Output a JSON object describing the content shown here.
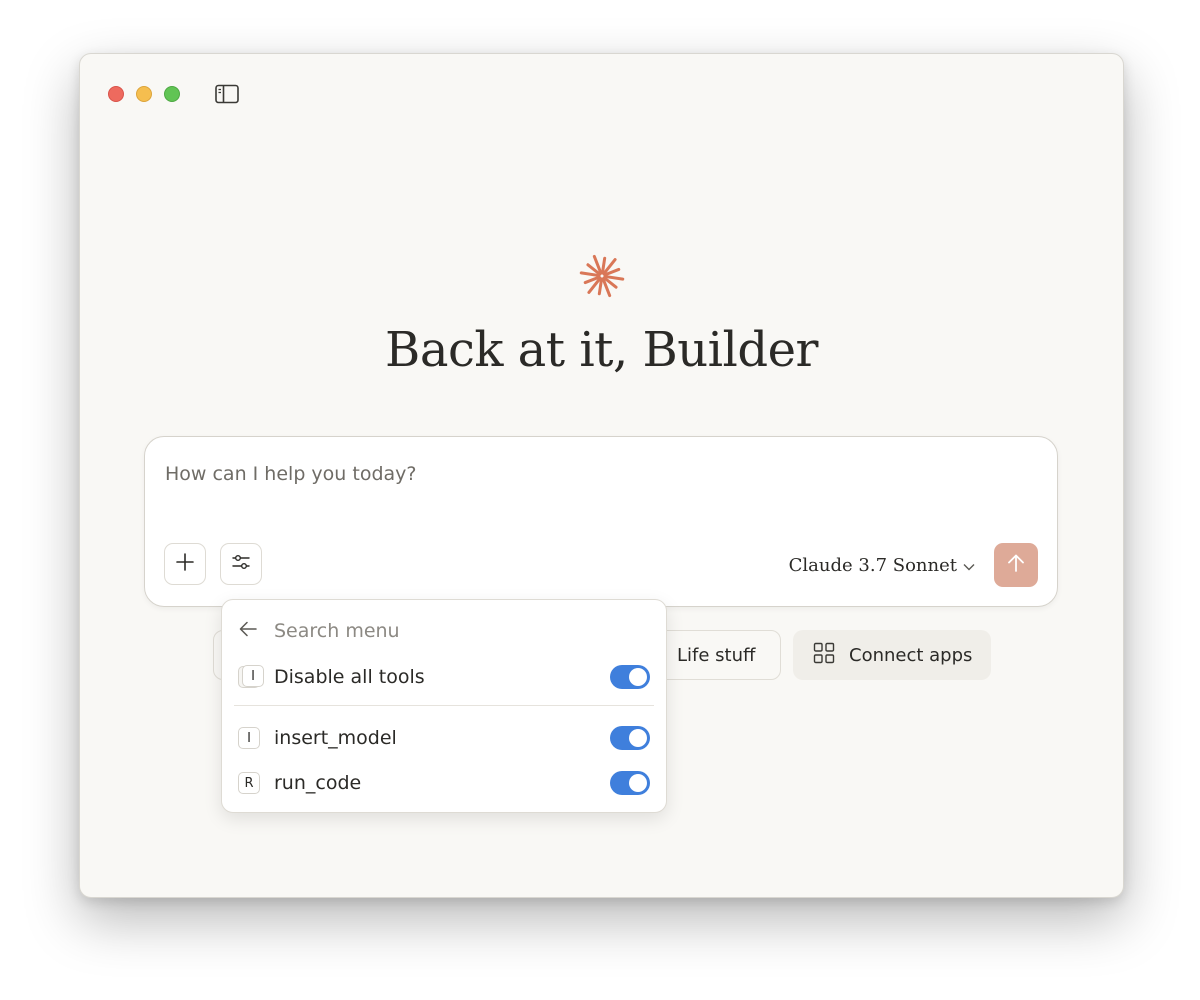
{
  "window": {
    "controls": [
      "close",
      "minimize",
      "zoom"
    ],
    "sidebar_toggle_icon": "sidebar-icon"
  },
  "hero": {
    "logo_icon": "sparkle-logo-icon",
    "logo_color": "#d97757",
    "greeting": "Back at it, Builder"
  },
  "composer": {
    "placeholder": "How can I help you today?",
    "value": "",
    "add_icon": "plus-icon",
    "tools_icon": "sliders-icon",
    "model_label": "Claude 3.7 Sonnet",
    "model_chevron_icon": "chevron-down-icon",
    "send_icon": "arrow-up-icon",
    "send_color": "#deaa98"
  },
  "chips": {
    "life": "Life stuff",
    "connect": "Connect apps",
    "connect_icon": "grid-icon"
  },
  "menu": {
    "back_icon": "arrow-left-icon",
    "search_placeholder": "Search menu",
    "disable_all": {
      "badge": "I",
      "label": "Disable all tools",
      "enabled": true
    },
    "tools": [
      {
        "badge": "I",
        "label": "insert_model",
        "enabled": true
      },
      {
        "badge": "R",
        "label": "run_code",
        "enabled": true
      }
    ],
    "toggle_color": "#3f7fdc"
  }
}
